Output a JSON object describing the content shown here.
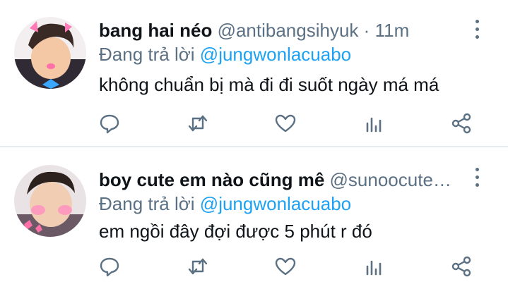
{
  "tweets": [
    {
      "display_name": "bang hai néo",
      "handle": "@antibangsihyuk",
      "separator": "·",
      "time": "11m",
      "replying_prefix": "Đang trả lời",
      "replying_to": "@jungwonlacuabo",
      "text": "không chuẩn bị mà đi đi suốt ngày má má"
    },
    {
      "display_name": "boy cute em nào cũng mê",
      "handle": "@sunoocute…",
      "separator": "",
      "time": "",
      "replying_prefix": "Đang trả lời",
      "replying_to": "@jungwonlacuabo",
      "text": "em ngồi đây đợi được 5 phút r đó"
    }
  ],
  "actions": [
    "reply-icon",
    "retweet-icon",
    "like-icon",
    "analytics-icon",
    "share-icon"
  ],
  "colors": {
    "icon": "#5b7083",
    "mention": "#1da1f2",
    "divider": "#e6ecf0"
  }
}
